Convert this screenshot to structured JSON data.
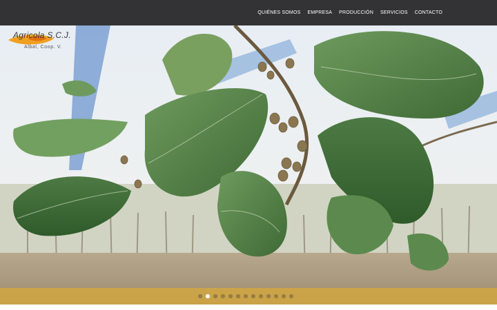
{
  "nav": {
    "items": [
      {
        "label": "QUIÉNES SOMOS"
      },
      {
        "label": "EMPRESA"
      },
      {
        "label": "PRODUCCIÓN"
      },
      {
        "label": "SERVICIOS"
      },
      {
        "label": "CONTACTO"
      }
    ]
  },
  "logo": {
    "title": "Agricola S.C.J.",
    "subtitle": "Albal, Coop. V."
  },
  "slider": {
    "total_slides": 13,
    "active_index": 1
  },
  "colors": {
    "topbar": "#333335",
    "dots_bar": "#d6a83c",
    "logo_accent": "#f0a020"
  }
}
